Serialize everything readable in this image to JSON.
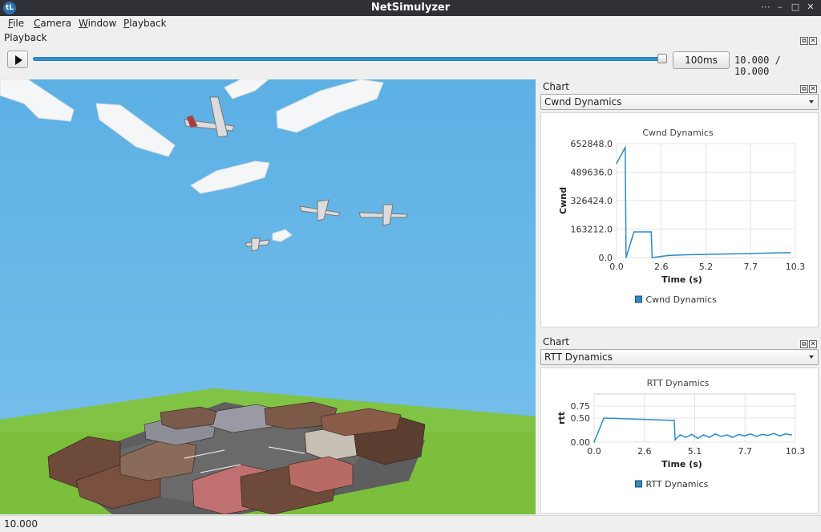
{
  "window": {
    "title": "NetSimulyzer",
    "icon_letter": "tL"
  },
  "menu": {
    "items": [
      {
        "label": "File",
        "u": "F",
        "rest": "ile"
      },
      {
        "label": "Camera",
        "u": "C",
        "rest": "amera"
      },
      {
        "label": "Window",
        "u": "W",
        "rest": "indow"
      },
      {
        "label": "Playback",
        "u": "P",
        "rest": "layback"
      }
    ]
  },
  "playback": {
    "dock_title": "Playback",
    "speed_label": "100ms",
    "time_readout": "10.000 / 10.000",
    "progress": 1.0
  },
  "charts": [
    {
      "dock_title": "Chart",
      "selected": "Cwnd Dynamics",
      "chart_data": {
        "type": "line",
        "title": "Cwnd Dynamics",
        "xlabel": "Time (s)",
        "ylabel": "Cwnd",
        "xlim": [
          0.0,
          10.3
        ],
        "ylim": [
          0.0,
          652848.0
        ],
        "xticks": [
          "0.0",
          "2.6",
          "5.2",
          "7.7",
          "10.3"
        ],
        "yticks": [
          "0.0",
          "163212.0",
          "326424.0",
          "489636.0",
          "652848.0"
        ],
        "legend": "bottom",
        "grid": true,
        "series": [
          {
            "name": "Cwnd Dynamics",
            "color": "#2d8bc6",
            "x": [
              0.0,
              0.5,
              0.55,
              1.0,
              2.0,
              2.05,
              3.0,
              4.0,
              5.0,
              6.0,
              7.0,
              8.0,
              9.0,
              10.0
            ],
            "y": [
              540000,
              630000,
              0,
              147000,
              147000,
              0,
              12000,
              16000,
              18000,
              20000,
              22000,
              24000,
              26000,
              28000
            ]
          }
        ]
      }
    },
    {
      "dock_title": "Chart",
      "selected": "RTT Dynamics",
      "chart_data": {
        "type": "line",
        "title": "RTT Dynamics",
        "xlabel": "Time (s)",
        "ylabel": "rtt",
        "xlim": [
          0.0,
          10.3
        ],
        "ylim": [
          0.0,
          1.0
        ],
        "xticks": [
          "0.0",
          "2.6",
          "5.1",
          "7.7",
          "10.3"
        ],
        "yticks": [
          "0.00",
          "0.50",
          "0.75"
        ],
        "ytick_values": [
          0.0,
          0.5,
          0.75
        ],
        "legend": "bottom",
        "grid": true,
        "series": [
          {
            "name": "RTT Dynamics",
            "color": "#2d8bc6",
            "x": [
              0.0,
              0.5,
              4.1,
              4.15,
              4.4,
              4.7,
              5.0,
              5.3,
              5.6,
              5.9,
              6.2,
              6.5,
              6.8,
              7.1,
              7.4,
              7.7,
              8.0,
              8.3,
              8.6,
              8.9,
              9.2,
              9.5,
              9.8,
              10.1
            ],
            "y": [
              0.0,
              0.5,
              0.45,
              0.05,
              0.15,
              0.1,
              0.16,
              0.08,
              0.15,
              0.1,
              0.17,
              0.12,
              0.15,
              0.1,
              0.16,
              0.13,
              0.17,
              0.12,
              0.16,
              0.14,
              0.18,
              0.13,
              0.17,
              0.15
            ]
          }
        ]
      }
    }
  ],
  "status": {
    "text": "10.000"
  }
}
